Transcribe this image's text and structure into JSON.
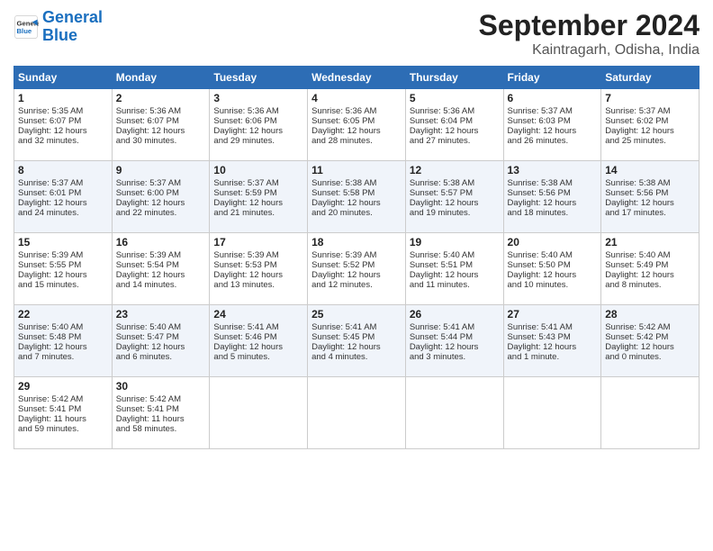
{
  "header": {
    "logo_line1": "General",
    "logo_line2": "Blue",
    "month": "September 2024",
    "location": "Kaintragarh, Odisha, India"
  },
  "weekdays": [
    "Sunday",
    "Monday",
    "Tuesday",
    "Wednesday",
    "Thursday",
    "Friday",
    "Saturday"
  ],
  "weeks": [
    [
      {
        "day": "1",
        "lines": [
          "Sunrise: 5:35 AM",
          "Sunset: 6:07 PM",
          "Daylight: 12 hours",
          "and 32 minutes."
        ]
      },
      {
        "day": "2",
        "lines": [
          "Sunrise: 5:36 AM",
          "Sunset: 6:07 PM",
          "Daylight: 12 hours",
          "and 30 minutes."
        ]
      },
      {
        "day": "3",
        "lines": [
          "Sunrise: 5:36 AM",
          "Sunset: 6:06 PM",
          "Daylight: 12 hours",
          "and 29 minutes."
        ]
      },
      {
        "day": "4",
        "lines": [
          "Sunrise: 5:36 AM",
          "Sunset: 6:05 PM",
          "Daylight: 12 hours",
          "and 28 minutes."
        ]
      },
      {
        "day": "5",
        "lines": [
          "Sunrise: 5:36 AM",
          "Sunset: 6:04 PM",
          "Daylight: 12 hours",
          "and 27 minutes."
        ]
      },
      {
        "day": "6",
        "lines": [
          "Sunrise: 5:37 AM",
          "Sunset: 6:03 PM",
          "Daylight: 12 hours",
          "and 26 minutes."
        ]
      },
      {
        "day": "7",
        "lines": [
          "Sunrise: 5:37 AM",
          "Sunset: 6:02 PM",
          "Daylight: 12 hours",
          "and 25 minutes."
        ]
      }
    ],
    [
      {
        "day": "8",
        "lines": [
          "Sunrise: 5:37 AM",
          "Sunset: 6:01 PM",
          "Daylight: 12 hours",
          "and 24 minutes."
        ]
      },
      {
        "day": "9",
        "lines": [
          "Sunrise: 5:37 AM",
          "Sunset: 6:00 PM",
          "Daylight: 12 hours",
          "and 22 minutes."
        ]
      },
      {
        "day": "10",
        "lines": [
          "Sunrise: 5:37 AM",
          "Sunset: 5:59 PM",
          "Daylight: 12 hours",
          "and 21 minutes."
        ]
      },
      {
        "day": "11",
        "lines": [
          "Sunrise: 5:38 AM",
          "Sunset: 5:58 PM",
          "Daylight: 12 hours",
          "and 20 minutes."
        ]
      },
      {
        "day": "12",
        "lines": [
          "Sunrise: 5:38 AM",
          "Sunset: 5:57 PM",
          "Daylight: 12 hours",
          "and 19 minutes."
        ]
      },
      {
        "day": "13",
        "lines": [
          "Sunrise: 5:38 AM",
          "Sunset: 5:56 PM",
          "Daylight: 12 hours",
          "and 18 minutes."
        ]
      },
      {
        "day": "14",
        "lines": [
          "Sunrise: 5:38 AM",
          "Sunset: 5:56 PM",
          "Daylight: 12 hours",
          "and 17 minutes."
        ]
      }
    ],
    [
      {
        "day": "15",
        "lines": [
          "Sunrise: 5:39 AM",
          "Sunset: 5:55 PM",
          "Daylight: 12 hours",
          "and 15 minutes."
        ]
      },
      {
        "day": "16",
        "lines": [
          "Sunrise: 5:39 AM",
          "Sunset: 5:54 PM",
          "Daylight: 12 hours",
          "and 14 minutes."
        ]
      },
      {
        "day": "17",
        "lines": [
          "Sunrise: 5:39 AM",
          "Sunset: 5:53 PM",
          "Daylight: 12 hours",
          "and 13 minutes."
        ]
      },
      {
        "day": "18",
        "lines": [
          "Sunrise: 5:39 AM",
          "Sunset: 5:52 PM",
          "Daylight: 12 hours",
          "and 12 minutes."
        ]
      },
      {
        "day": "19",
        "lines": [
          "Sunrise: 5:40 AM",
          "Sunset: 5:51 PM",
          "Daylight: 12 hours",
          "and 11 minutes."
        ]
      },
      {
        "day": "20",
        "lines": [
          "Sunrise: 5:40 AM",
          "Sunset: 5:50 PM",
          "Daylight: 12 hours",
          "and 10 minutes."
        ]
      },
      {
        "day": "21",
        "lines": [
          "Sunrise: 5:40 AM",
          "Sunset: 5:49 PM",
          "Daylight: 12 hours",
          "and 8 minutes."
        ]
      }
    ],
    [
      {
        "day": "22",
        "lines": [
          "Sunrise: 5:40 AM",
          "Sunset: 5:48 PM",
          "Daylight: 12 hours",
          "and 7 minutes."
        ]
      },
      {
        "day": "23",
        "lines": [
          "Sunrise: 5:40 AM",
          "Sunset: 5:47 PM",
          "Daylight: 12 hours",
          "and 6 minutes."
        ]
      },
      {
        "day": "24",
        "lines": [
          "Sunrise: 5:41 AM",
          "Sunset: 5:46 PM",
          "Daylight: 12 hours",
          "and 5 minutes."
        ]
      },
      {
        "day": "25",
        "lines": [
          "Sunrise: 5:41 AM",
          "Sunset: 5:45 PM",
          "Daylight: 12 hours",
          "and 4 minutes."
        ]
      },
      {
        "day": "26",
        "lines": [
          "Sunrise: 5:41 AM",
          "Sunset: 5:44 PM",
          "Daylight: 12 hours",
          "and 3 minutes."
        ]
      },
      {
        "day": "27",
        "lines": [
          "Sunrise: 5:41 AM",
          "Sunset: 5:43 PM",
          "Daylight: 12 hours",
          "and 1 minute."
        ]
      },
      {
        "day": "28",
        "lines": [
          "Sunrise: 5:42 AM",
          "Sunset: 5:42 PM",
          "Daylight: 12 hours",
          "and 0 minutes."
        ]
      }
    ],
    [
      {
        "day": "29",
        "lines": [
          "Sunrise: 5:42 AM",
          "Sunset: 5:41 PM",
          "Daylight: 11 hours",
          "and 59 minutes."
        ]
      },
      {
        "day": "30",
        "lines": [
          "Sunrise: 5:42 AM",
          "Sunset: 5:41 PM",
          "Daylight: 11 hours",
          "and 58 minutes."
        ]
      },
      {
        "day": "",
        "lines": []
      },
      {
        "day": "",
        "lines": []
      },
      {
        "day": "",
        "lines": []
      },
      {
        "day": "",
        "lines": []
      },
      {
        "day": "",
        "lines": []
      }
    ]
  ]
}
